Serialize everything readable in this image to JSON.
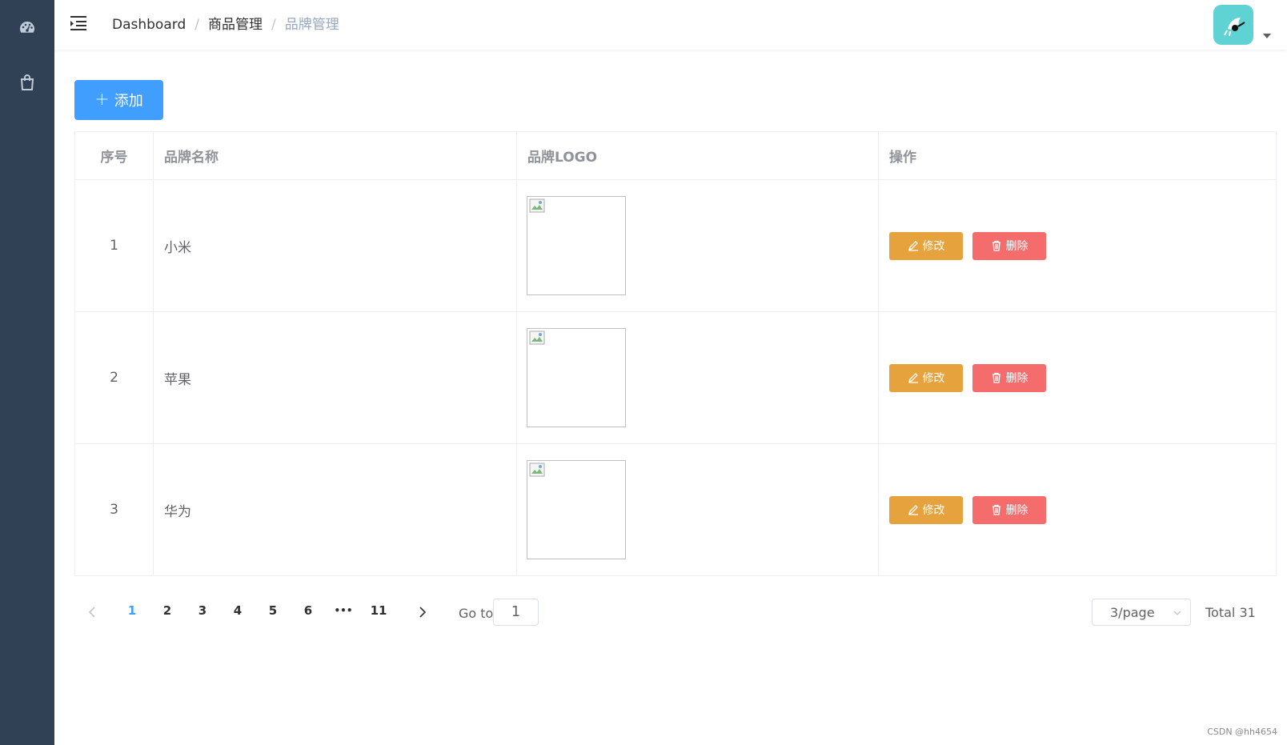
{
  "sidebar": {
    "items": [
      {
        "icon": "dashboard-icon"
      },
      {
        "icon": "shopping-bag-icon"
      }
    ]
  },
  "navbar": {
    "breadcrumb": [
      "Dashboard",
      "商品管理",
      "品牌管理"
    ]
  },
  "toolbar": {
    "add_label": "添加"
  },
  "table": {
    "headers": [
      "序号",
      "品牌名称",
      "品牌LOGO",
      "操作"
    ],
    "rows": [
      {
        "index": "1",
        "name": "小米"
      },
      {
        "index": "2",
        "name": "苹果"
      },
      {
        "index": "3",
        "name": "华为"
      }
    ],
    "edit_label": "修改",
    "delete_label": "删除"
  },
  "pagination": {
    "pages": [
      "1",
      "2",
      "3",
      "4",
      "5",
      "6",
      "•••",
      "11"
    ],
    "current_page": "1",
    "goto_label": "Go to",
    "goto_value": "1",
    "page_size": "3/page",
    "total": "Total 31"
  },
  "watermark": "CSDN @hh4654",
  "colors": {
    "sidebar_bg": "#304156",
    "primary": "#409eff",
    "warning": "#e6a23c",
    "danger": "#f56c6c",
    "avatar_bg": "#5fd3d3"
  }
}
